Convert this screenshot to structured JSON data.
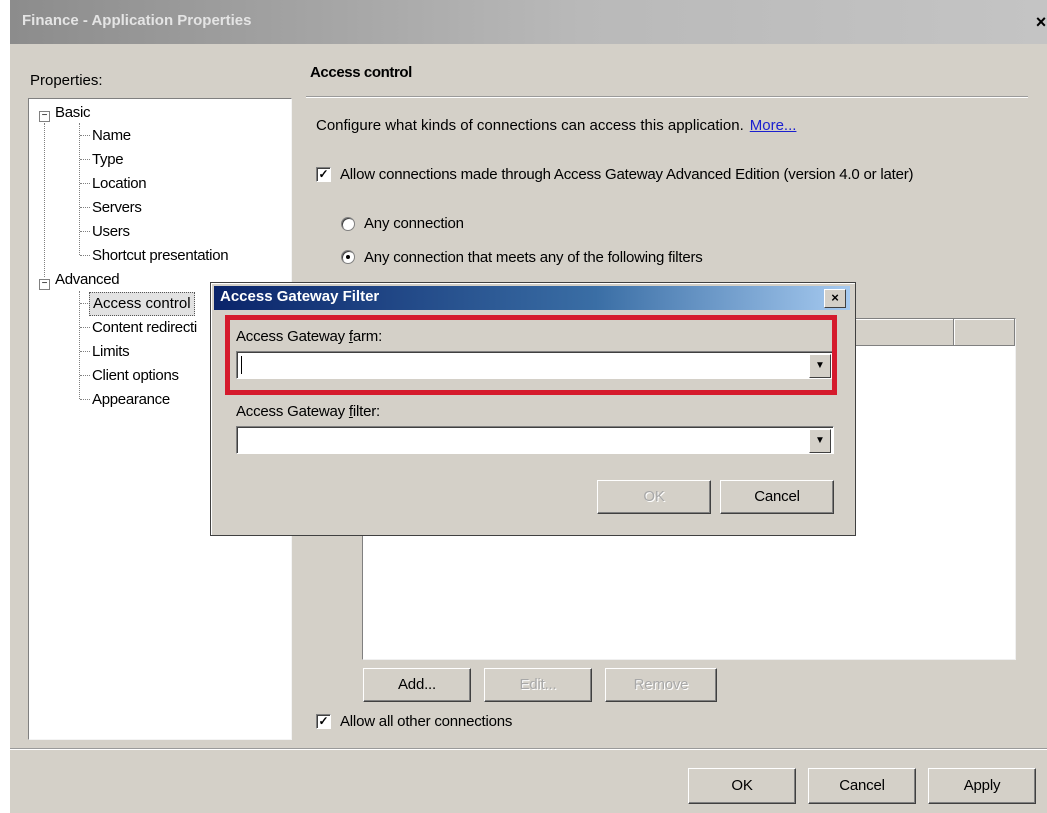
{
  "window": {
    "title": "Finance - Application Properties",
    "close_glyph": "×"
  },
  "properties": {
    "label": "Properties:",
    "tree": {
      "basic": "Basic",
      "basic_children": [
        "Name",
        "Type",
        "Location",
        "Servers",
        "Users",
        "Shortcut presentation"
      ],
      "advanced": "Advanced",
      "advanced_children": [
        "Access control",
        "Content redirecti",
        "Limits",
        "Client options",
        "Appearance"
      ],
      "expanded_glyph": "−",
      "selected": "Access control"
    }
  },
  "access_control": {
    "title": "Access control",
    "description": "Configure what kinds of connections can access this application.",
    "more_link": "More...",
    "allow_agae_label": "Allow connections made through Access Gateway Advanced Edition (version 4.0 or later)",
    "allow_agae_checked": true,
    "radio_any": "Any connection",
    "radio_filters": "Any connection that meets any of the following filters",
    "radio_selected": "filters",
    "buttons": {
      "add": "Add...",
      "edit": "Edit...",
      "remove": "Remove"
    },
    "allow_other_label": "Allow all other connections",
    "allow_other_checked": true
  },
  "footer": {
    "ok": "OK",
    "cancel": "Cancel",
    "apply": "Apply"
  },
  "dialog": {
    "title": "Access Gateway Filter",
    "close_glyph": "×",
    "farm_label_pre": "Access Gateway ",
    "farm_label_key": "f",
    "farm_label_post": "arm:",
    "farm_value": "",
    "filter_label_pre": "Access Gateway ",
    "filter_label_key": "f",
    "filter_label_post": "ilter:",
    "filter_value": "",
    "ok": "OK",
    "cancel": "Cancel",
    "dropdown_glyph": "▼"
  },
  "colors": {
    "highlight": "#d51a2c",
    "link": "#1a1fcf",
    "dialog_title_bar": "#0a246a"
  },
  "checkbox_glyph": "✓"
}
